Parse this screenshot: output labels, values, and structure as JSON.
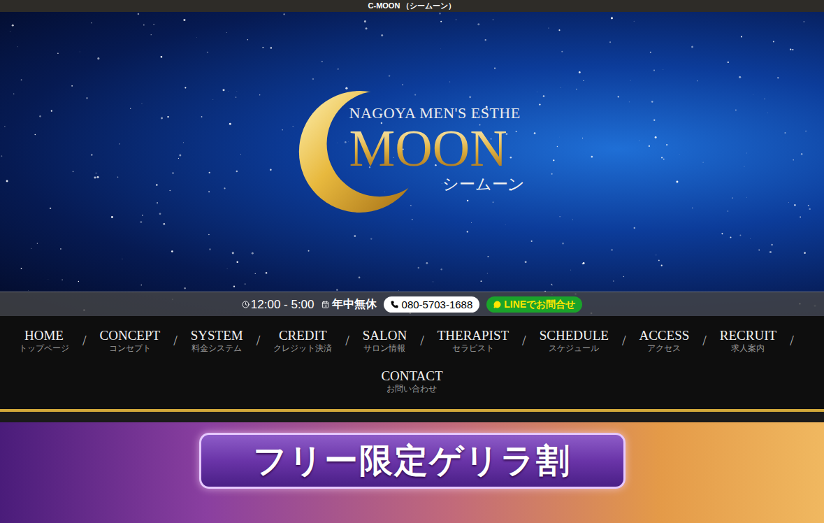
{
  "top_bar": {
    "title": "C-MOON （シームーン）"
  },
  "logo": {
    "tagline": "NAGOYA MEN'S ESTHE",
    "name": "MOON",
    "kana": "シームーン"
  },
  "info_bar": {
    "hours": "12:00 - 5:00",
    "holiday": "年中無休",
    "phone": "080-5703-1688",
    "line_button": "LINEでお問合せ"
  },
  "nav": {
    "separator": "/",
    "rows": [
      [
        {
          "en": "HOME",
          "ja": "トップページ"
        },
        {
          "en": "CONCEPT",
          "ja": "コンセプト"
        },
        {
          "en": "SYSTEM",
          "ja": "料金システム"
        },
        {
          "en": "CREDIT",
          "ja": "クレジット決済"
        },
        {
          "en": "SALON",
          "ja": "サロン情報"
        },
        {
          "en": "THERAPIST",
          "ja": "セラピスト"
        },
        {
          "en": "SCHEDULE",
          "ja": "スケジュール"
        },
        {
          "en": "ACCESS",
          "ja": "アクセス"
        },
        {
          "en": "RECRUIT",
          "ja": "求人案内"
        }
      ],
      [
        {
          "en": "CONTACT",
          "ja": "お問い合わせ"
        }
      ]
    ]
  },
  "banner": {
    "title": "フリー限定ゲリラ割"
  }
}
